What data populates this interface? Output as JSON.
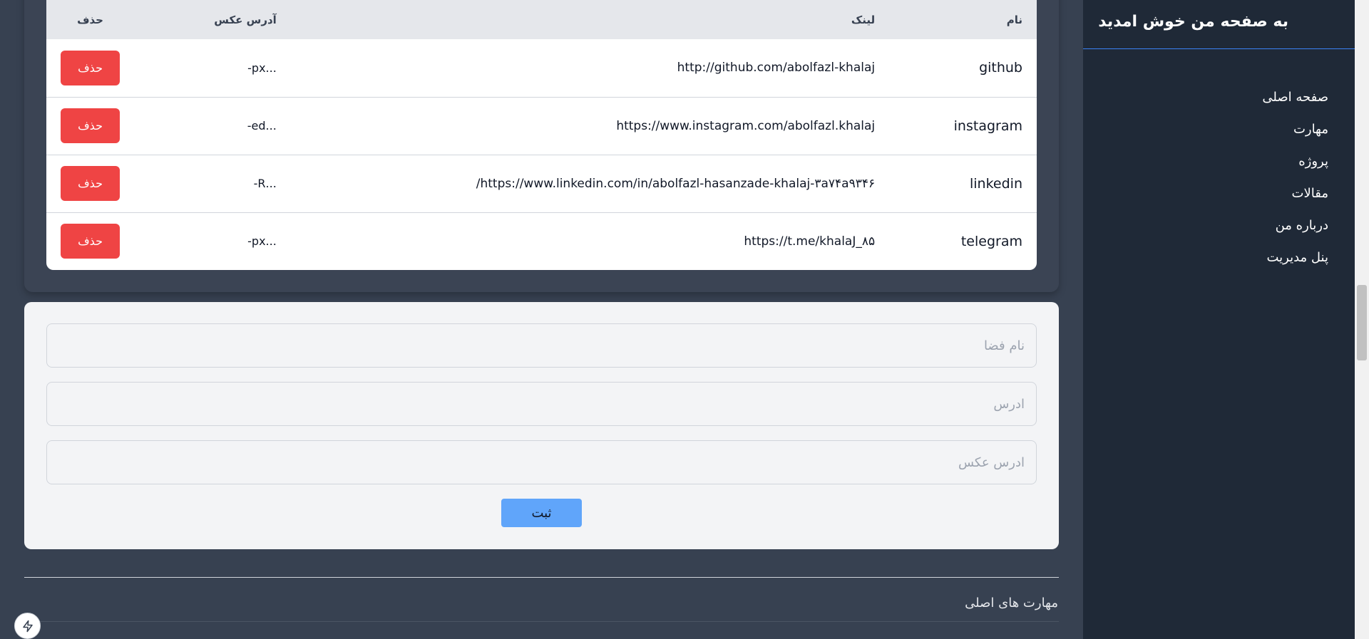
{
  "table": {
    "headers": {
      "name": "نام",
      "link": "لینک",
      "image": "آدرس عکس",
      "delete": "حذف"
    },
    "rows": [
      {
        "name": "github",
        "link": "http://github.com/abolfazl-khalaj",
        "image": "...px-",
        "delete": "حذف"
      },
      {
        "name": "instagram",
        "link": "https://www.instagram.com/abolfazl.khalaj",
        "image": "...ed-",
        "delete": "حذف"
      },
      {
        "name": "linkedin",
        "link": "https://www.linkedin.com/in/abolfazl-hasanzade-khalaj-۳a۷۴a۹۳۴۶/",
        "image": "...R-",
        "delete": "حذف"
      },
      {
        "name": "telegram",
        "link": "https://t.me/khalaJ_۸۵",
        "image": "...px-",
        "delete": "حذف"
      }
    ]
  },
  "form": {
    "name_placeholder": "نام فضا",
    "address_placeholder": "ادرس",
    "image_placeholder": "ادرس عکس",
    "submit_label": "ثبت"
  },
  "section": {
    "title": "مهارت های اصلی"
  },
  "sidebar": {
    "title": "به صفحه من خوش امدید",
    "items": [
      {
        "label": "صفحه اصلی"
      },
      {
        "label": "مهارت"
      },
      {
        "label": "پروژه"
      },
      {
        "label": "مقالات"
      },
      {
        "label": "درباره من"
      },
      {
        "label": "پنل مدیریت"
      }
    ]
  },
  "colors": {
    "accent": "#60a5fa",
    "danger": "#ef4444",
    "sidebar_bg": "#1f2937",
    "main_bg": "#374151"
  }
}
